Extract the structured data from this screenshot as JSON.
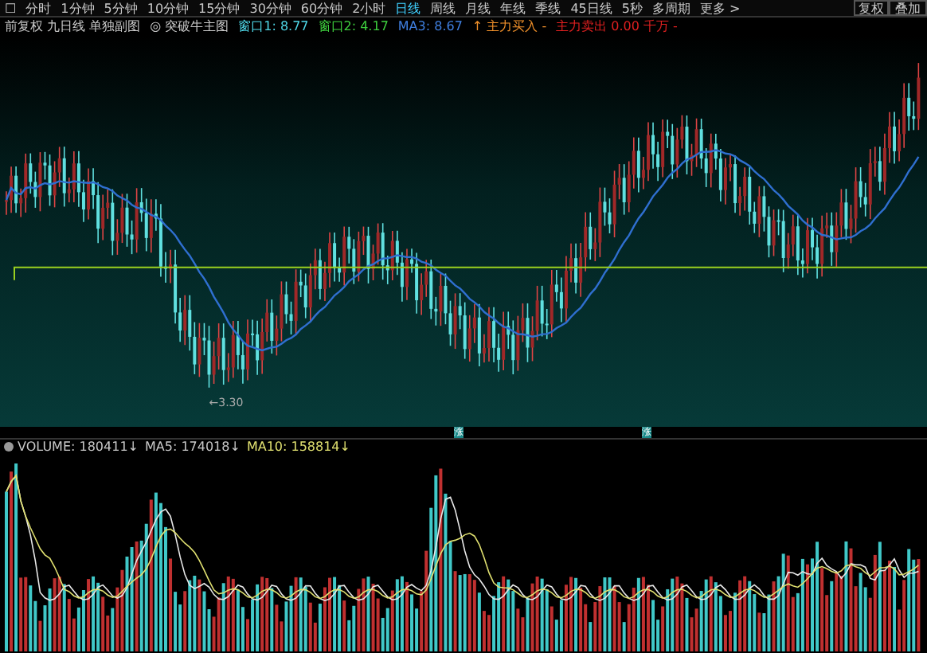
{
  "toolbar": {
    "menu_icon": "☐",
    "periods": [
      {
        "label": "分时",
        "selected": false
      },
      {
        "label": "1分钟",
        "selected": false
      },
      {
        "label": "5分钟",
        "selected": false
      },
      {
        "label": "10分钟",
        "selected": false
      },
      {
        "label": "15分钟",
        "selected": false
      },
      {
        "label": "30分钟",
        "selected": false
      },
      {
        "label": "60分钟",
        "selected": false
      },
      {
        "label": "2小时",
        "selected": false
      },
      {
        "label": "日线",
        "selected": true
      },
      {
        "label": "周线",
        "selected": false
      },
      {
        "label": "月线",
        "selected": false
      },
      {
        "label": "年线",
        "selected": false
      },
      {
        "label": "季线",
        "selected": false
      },
      {
        "label": "45日线",
        "selected": false
      },
      {
        "label": "5秒",
        "selected": false
      },
      {
        "label": "多周期",
        "selected": false
      }
    ],
    "more": "更多 >",
    "right_buttons": [
      "复权",
      "叠加"
    ]
  },
  "indicator_bar": {
    "items": [
      {
        "text": "前复权 九日线 单独副图",
        "color": "#c8c8c8"
      },
      {
        "text": "◎ 突破牛主图",
        "color": "#c8c8c8"
      },
      {
        "text": "窗口1: 8.77",
        "color": "#4fd8e8"
      },
      {
        "text": "窗口2: 4.17",
        "color": "#3ecf3e"
      },
      {
        "text": "MA3: 8.67",
        "color": "#3f7fe0"
      },
      {
        "text": "↑ 主力买入 -",
        "color": "#f0902a"
      },
      {
        "text": "主力卖出 0.00 千万 -",
        "color": "#e02020"
      }
    ]
  },
  "price_chart": {
    "low_label": "←3.30",
    "markers": [
      "涨",
      "涨"
    ]
  },
  "volume_chart": {
    "readings": [
      {
        "text": "VOLUME: 180411↓",
        "color": "#c8c8c8"
      },
      {
        "text": "MA5: 174018↓",
        "color": "#c8c8c8"
      },
      {
        "text": "MA10: 158814↓",
        "color": "#e0e070"
      }
    ]
  }
}
